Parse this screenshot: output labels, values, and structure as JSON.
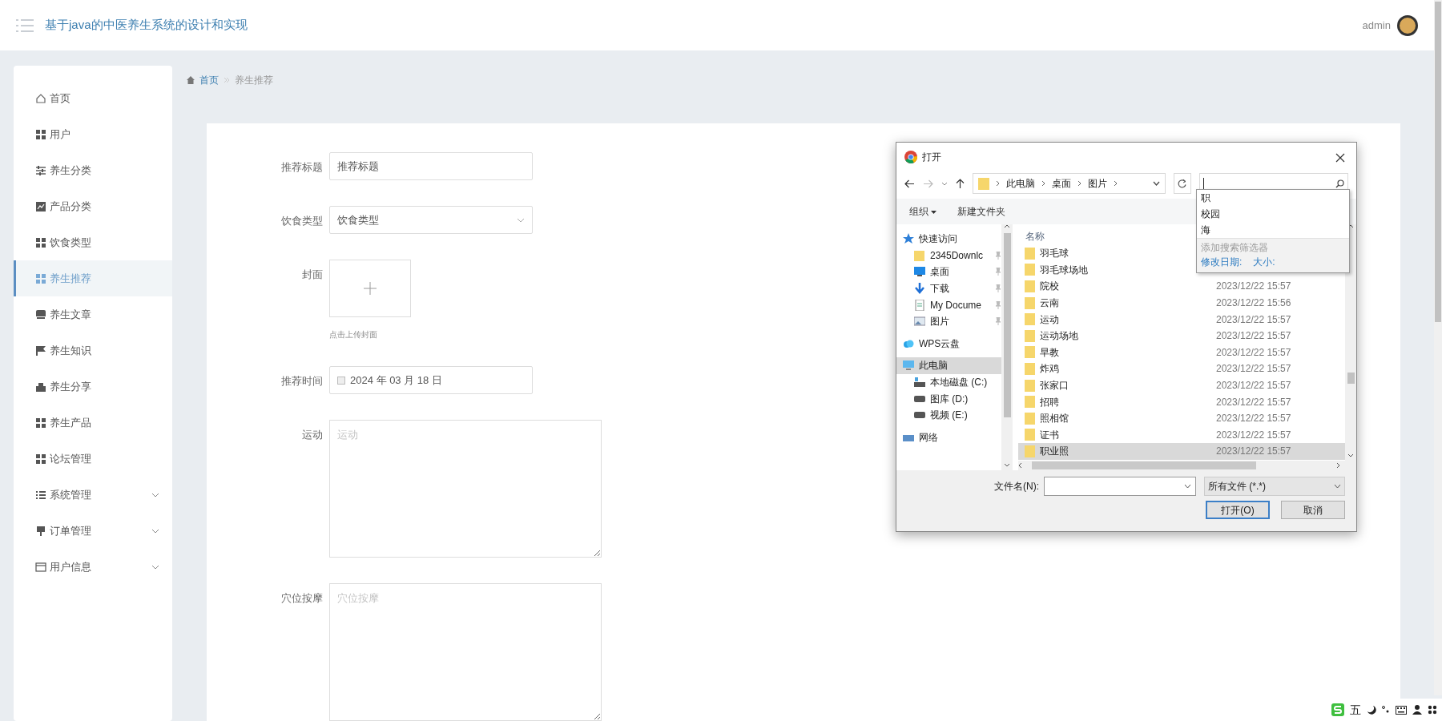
{
  "header": {
    "title": "基于java的中医养生系统的设计和实现",
    "user": "admin"
  },
  "sidebar": {
    "items": [
      {
        "label": "首页",
        "kind": "link",
        "selected": false
      },
      {
        "label": "用户",
        "kind": "link",
        "selected": false
      },
      {
        "label": "养生分类",
        "kind": "link",
        "selected": false
      },
      {
        "label": "产品分类",
        "kind": "link",
        "selected": false
      },
      {
        "label": "饮食类型",
        "kind": "link",
        "selected": false
      },
      {
        "label": "养生推荐",
        "kind": "link",
        "selected": true
      },
      {
        "label": "养生文章",
        "kind": "link",
        "selected": false
      },
      {
        "label": "养生知识",
        "kind": "link",
        "selected": false
      },
      {
        "label": "养生分享",
        "kind": "link",
        "selected": false
      },
      {
        "label": "养生产品",
        "kind": "link",
        "selected": false
      },
      {
        "label": "论坛管理",
        "kind": "link",
        "selected": false
      },
      {
        "label": "系统管理",
        "kind": "submenu",
        "selected": false
      },
      {
        "label": "订单管理",
        "kind": "submenu",
        "selected": false
      },
      {
        "label": "用户信息",
        "kind": "submenu",
        "selected": false
      }
    ]
  },
  "breadcrumb": [
    "首页",
    "养生推荐"
  ],
  "form": {
    "fields": [
      {
        "label": "推荐标题",
        "kind": "text",
        "value": "推荐标题"
      },
      {
        "label": "饮食类型",
        "kind": "select",
        "value": "饮食类型"
      },
      {
        "label": "封面",
        "kind": "upload",
        "hint": "点击上传封面"
      },
      {
        "label": "推荐时间",
        "kind": "date",
        "value": "2024 年 03 月 18 日"
      },
      {
        "label": "运动",
        "kind": "textarea",
        "placeholder": "运动"
      },
      {
        "label": "穴位按摩",
        "kind": "textarea",
        "placeholder": "穴位按摩"
      }
    ]
  },
  "dialog": {
    "title": "打开",
    "path": [
      "此电脑",
      "桌面",
      "图片"
    ],
    "toolbar": [
      "组织",
      "新建文件夹"
    ],
    "search_suggestions": [
      "职",
      "校园",
      "海"
    ],
    "filter_heading": "添加搜索筛选器",
    "filters": [
      "修改日期:",
      "大小:"
    ],
    "nav_tree": [
      {
        "label": "快速访问",
        "selected": false,
        "children": [
          {
            "label": "2345Downlc",
            "selected": false
          },
          {
            "label": "桌面",
            "selected": false
          },
          {
            "label": "下载",
            "selected": false
          },
          {
            "label": "My Docume",
            "selected": false
          },
          {
            "label": "图片",
            "selected": false
          }
        ]
      },
      {
        "label": "WPS云盘",
        "selected": false
      },
      {
        "label": "此电脑",
        "selected": true,
        "children": [
          {
            "label": "本地磁盘 (C:)",
            "selected": false
          },
          {
            "label": "图库 (D:)",
            "selected": false
          },
          {
            "label": "视频 (E:)",
            "selected": false
          }
        ]
      },
      {
        "label": "网络",
        "selected": false
      }
    ],
    "column_header": "名称",
    "files": [
      {
        "name": "羽毛球",
        "selected": false
      },
      {
        "name": "羽毛球场地",
        "selected": false
      },
      {
        "name": "院校",
        "date": "2023/12/22 15:57",
        "selected": false
      },
      {
        "name": "云南",
        "date": "2023/12/22 15:56",
        "selected": false
      },
      {
        "name": "运动",
        "date": "2023/12/22 15:57",
        "selected": false
      },
      {
        "name": "运动场地",
        "date": "2023/12/22 15:57",
        "selected": false
      },
      {
        "name": "早教",
        "date": "2023/12/22 15:57",
        "selected": false
      },
      {
        "name": "炸鸡",
        "date": "2023/12/22 15:57",
        "selected": false
      },
      {
        "name": "张家口",
        "date": "2023/12/22 15:57",
        "selected": false
      },
      {
        "name": "招聘",
        "date": "2023/12/22 15:57",
        "selected": false
      },
      {
        "name": "照相馆",
        "date": "2023/12/22 15:57",
        "selected": false
      },
      {
        "name": "证书",
        "date": "2023/12/22 15:57",
        "selected": false
      },
      {
        "name": "职业照",
        "date": "2023/12/22 15:57",
        "selected": true
      }
    ],
    "filename_label": "文件名(N):",
    "filetype": "所有文件 (*.*)",
    "buttons": [
      {
        "label": "打开(O)",
        "kind": "primary"
      },
      {
        "label": "取消",
        "kind": "secondary"
      }
    ]
  },
  "ime_bar": {
    "mode": "五"
  }
}
